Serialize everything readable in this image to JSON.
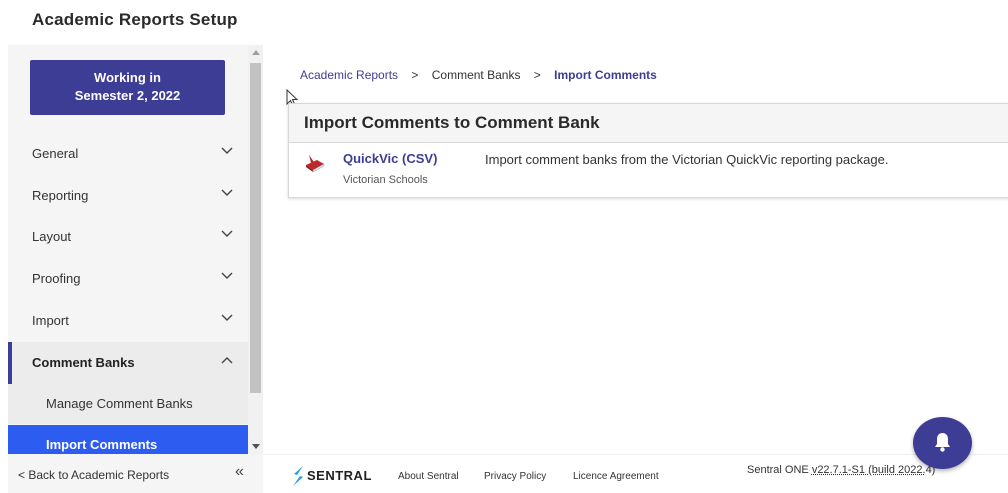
{
  "page": {
    "title": "Academic Reports Setup"
  },
  "sidebar": {
    "working_line1": "Working in",
    "working_line2": "Semester 2, 2022",
    "items": [
      {
        "label": "General",
        "expanded": false
      },
      {
        "label": "Reporting",
        "expanded": false
      },
      {
        "label": "Layout",
        "expanded": false
      },
      {
        "label": "Proofing",
        "expanded": false
      },
      {
        "label": "Import",
        "expanded": false
      },
      {
        "label": "Comment Banks",
        "expanded": true
      }
    ],
    "sub_items": [
      {
        "label": "Manage Comment Banks",
        "selected": false
      },
      {
        "label": "Import Comments",
        "selected": true
      }
    ],
    "back_label": "Back to Academic Reports",
    "back_glyph": "<",
    "collapse_glyph": "«"
  },
  "breadcrumb": {
    "items": [
      "Academic Reports",
      "Comment Banks",
      "Import Comments"
    ],
    "separator": ">"
  },
  "panel": {
    "title": "Import Comments to Comment Bank",
    "rows": [
      {
        "name": "QuickVic (CSV)",
        "subtitle": "Victorian Schools",
        "description": "Import comment banks from the Victorian QuickVic reporting package.",
        "icon": "book-icon"
      }
    ]
  },
  "footer": {
    "brand": "SENTRAL",
    "links": [
      "About Sentral",
      "Privacy Policy",
      "Licence Agreement"
    ],
    "version_prefix": "Sentral ONE ",
    "version": "v22.7.1-S1 (build 2022.",
    "version_tail": "4)"
  },
  "colors": {
    "brand": "#3d3d96",
    "selected": "#2c5cf0",
    "accent_icon": "#c0282d"
  }
}
